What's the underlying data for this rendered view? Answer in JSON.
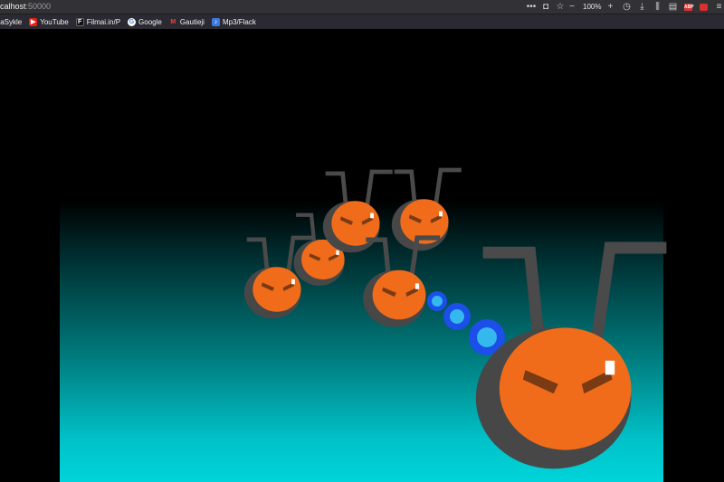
{
  "browser": {
    "url_host": "calhost",
    "url_port": ":50000",
    "zoom_level": "100%",
    "icons": [
      "more-icon",
      "pocket-icon",
      "bookmark-star-icon"
    ],
    "toolbar_icons": [
      "history-icon",
      "downloads-icon",
      "library-icon",
      "reader-view-icon",
      "adblock-icon",
      "extension-icon",
      "menu-icon"
    ],
    "adblock_badge": "ABP"
  },
  "bookmarks": [
    {
      "label": "inaSykle",
      "icon": "blank-icon"
    },
    {
      "label": "YouTube",
      "icon": "youtube-icon"
    },
    {
      "label": "Filmai.in/P",
      "icon": "filmai-icon"
    },
    {
      "label": "Google",
      "icon": "google-icon"
    },
    {
      "label": "Gautieji",
      "icon": "gmail-icon"
    },
    {
      "label": "Mp3/Flack",
      "icon": "mp3-icon"
    }
  ],
  "game": {
    "colors": {
      "enemy_body": "#f06c1a",
      "enemy_outline": "#444444",
      "projectile_outer": "#1c4ee8",
      "projectile_inner": "#35b8ee",
      "background_top": "#000000",
      "background_bottom": "#00d4da"
    },
    "enemies_count": 5,
    "projectiles_count": 3,
    "player": "orange-bug"
  }
}
